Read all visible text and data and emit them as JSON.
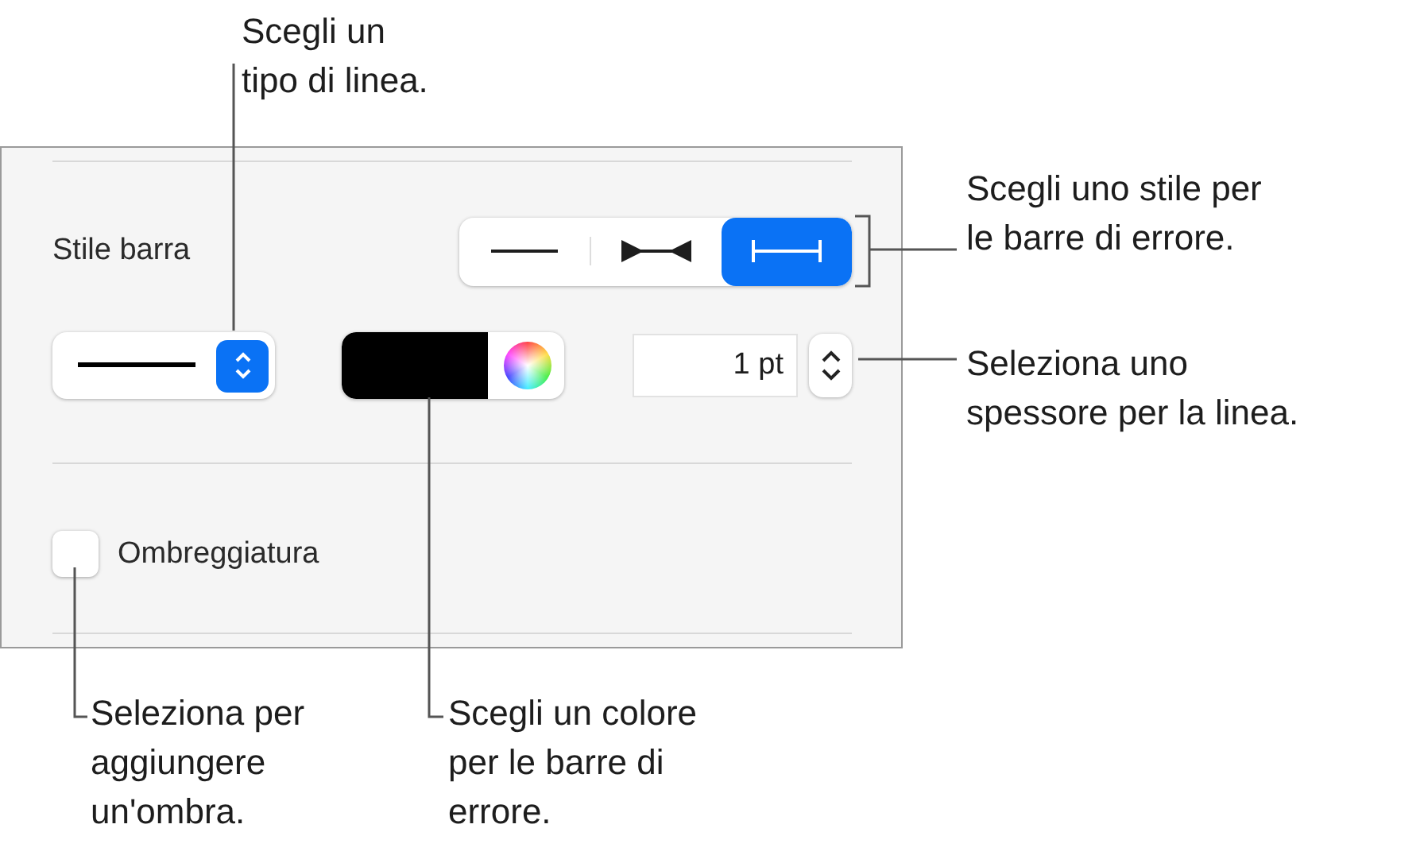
{
  "panel": {
    "bar_style_label": "Stile barra",
    "segments": [
      {
        "kind": "plain",
        "selected": false
      },
      {
        "kind": "inward",
        "selected": false
      },
      {
        "kind": "capped",
        "selected": true
      }
    ],
    "width_value": "1 pt",
    "shadow": {
      "label": "Ombreggiatura",
      "checked": false
    }
  },
  "callouts": [
    {
      "kind": "top",
      "lines": [
        "Scegli un",
        "tipo di linea."
      ]
    },
    {
      "kind": "right-style",
      "lines": [
        "Scegli uno stile per",
        "le barre di errore."
      ]
    },
    {
      "kind": "right-width",
      "lines": [
        "Seleziona uno",
        "spessore per la linea."
      ]
    },
    {
      "kind": "bottom-left",
      "lines": [
        "Seleziona per",
        "aggiungere",
        "un'ombra."
      ]
    },
    {
      "kind": "bottom-mid",
      "lines": [
        "Scegli un colore",
        "per le barre di",
        "errore."
      ]
    }
  ]
}
